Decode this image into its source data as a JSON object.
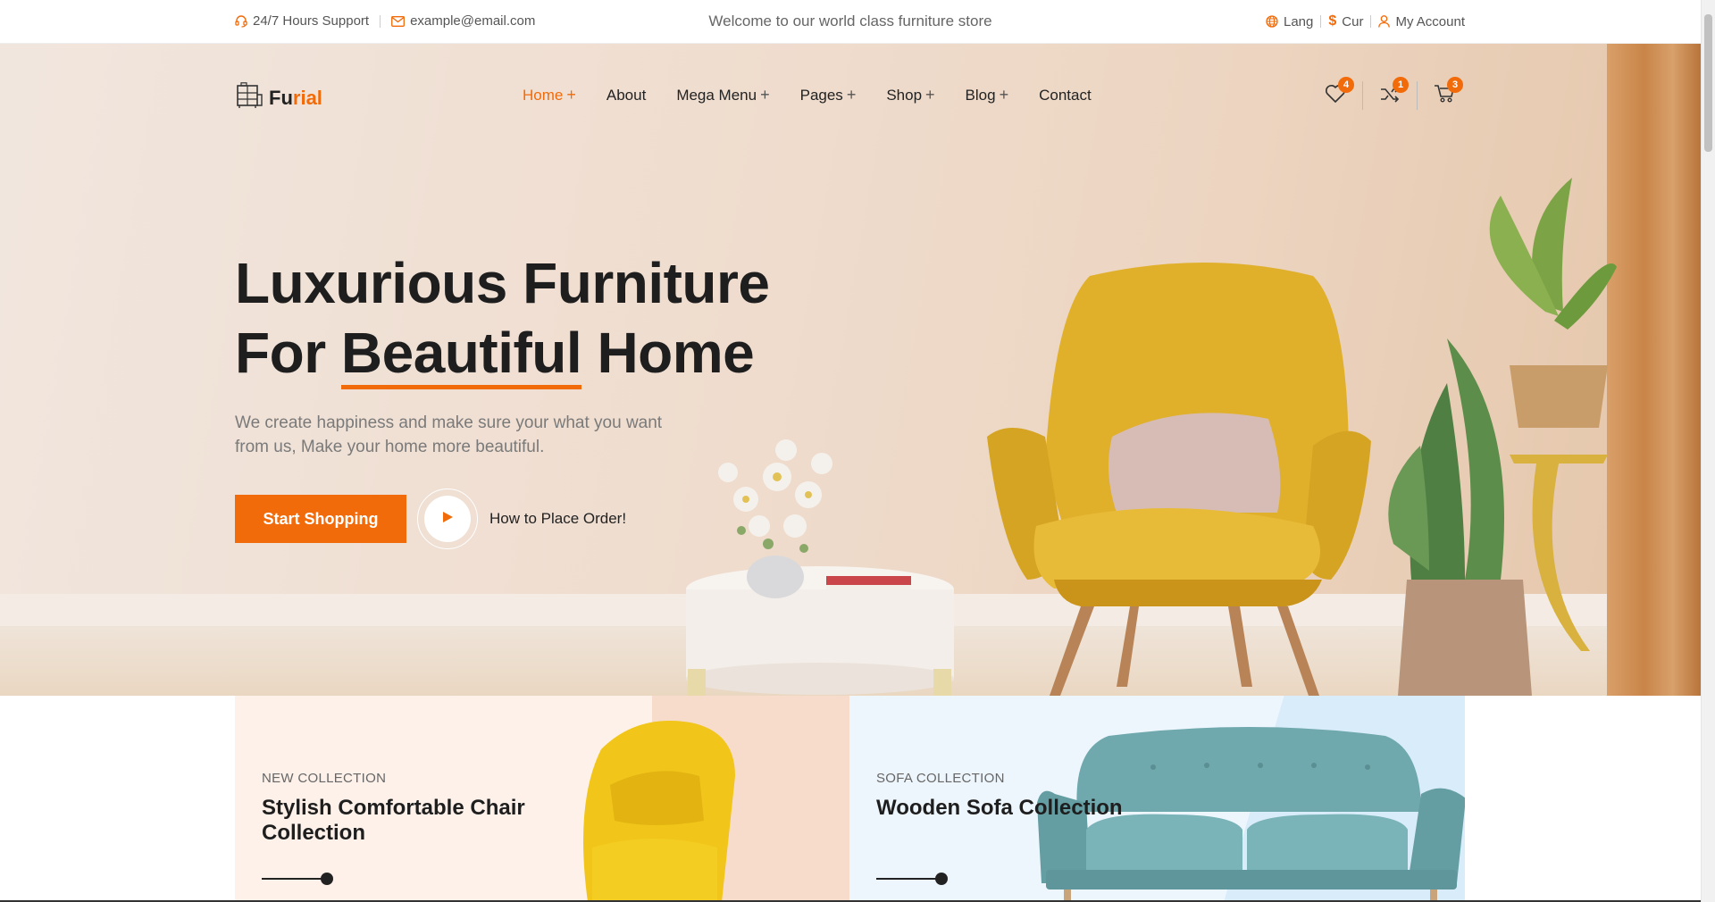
{
  "topbar": {
    "support": "24/7 Hours Support",
    "email": "example@email.com",
    "welcome": "Welcome to our world class furniture store",
    "lang": "Lang",
    "cur": "Cur",
    "account": "My Account"
  },
  "logo": {
    "part1": "Fu",
    "part2": "rial"
  },
  "nav": {
    "home": "Home",
    "about": "About",
    "mega": "Mega Menu",
    "pages": "Pages",
    "shop": "Shop",
    "blog": "Blog",
    "contact": "Contact",
    "plus": "+"
  },
  "badges": {
    "wishlist": "4",
    "compare": "1",
    "cart": "3"
  },
  "hero": {
    "line1": "Luxurious Furniture",
    "line2_a": "For ",
    "line2_u": "Beautiful",
    "line2_b": " Home",
    "subtitle": "We create happiness and make sure your what you want from us, Make your home more beautiful.",
    "cta": "Start Shopping",
    "video_label": "How to Place Order!"
  },
  "cards": [
    {
      "tag": "NEW COLLECTION",
      "title": "Stylish Comfortable Chair Collection"
    },
    {
      "tag": "SOFA COLLECTION",
      "title": "Wooden Sofa Collection"
    }
  ],
  "colors": {
    "accent": "#f26b0a",
    "dark": "#1e1e1e",
    "chair": "#e6b52e",
    "sofa": "#6fa8ad"
  }
}
